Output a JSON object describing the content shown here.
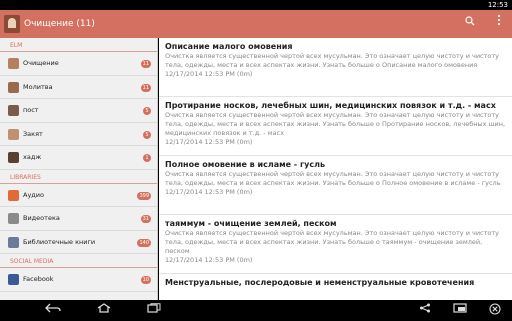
{
  "status_bar": {
    "time": "12:53"
  },
  "action_bar": {
    "title": "Очищение (11)",
    "search_icon": "search-icon",
    "overflow_icon": "overflow-menu-icon",
    "accent_color": "#d4705f"
  },
  "drawer": {
    "sections": [
      {
        "header": "ELM",
        "items": [
          {
            "label": "Очищение",
            "badge": "11",
            "icon": "kneeling-figure-icon"
          },
          {
            "label": "Молитва",
            "badge": "11",
            "icon": "prayer-figure-icon"
          },
          {
            "label": "пост",
            "badge": "5",
            "icon": "fasting-icon"
          },
          {
            "label": "Закят",
            "badge": "5",
            "icon": "zakat-icon"
          },
          {
            "label": "хадж",
            "badge": "1",
            "icon": "hajj-icon"
          }
        ]
      },
      {
        "header": "LIBRARIES",
        "items": [
          {
            "label": "Аудио",
            "badge": "399",
            "icon": "audio-icon"
          },
          {
            "label": "Видеотека",
            "badge": "31",
            "icon": "video-icon"
          },
          {
            "label": "Библиотечные книги",
            "badge": "140",
            "icon": "books-icon"
          }
        ]
      },
      {
        "header": "SOCIAL MEDIA",
        "items": [
          {
            "label": "Facebook",
            "badge": "10",
            "icon": "facebook-icon"
          }
        ]
      }
    ]
  },
  "articles": [
    {
      "title": "Описание малого омовения",
      "body": "Очистка является существенной чертой всех мусульман. Это означает целую чистоту и чистоту тела, одежды, места и всех аспектах жизни. Узнать больше о Описание малого омовения",
      "date": "12/17/2014 12:53 PM (0m)"
    },
    {
      "title": "Протирание носков, лечебных шин, медицинских повязок и т.д. - масх",
      "body": "Очистка является существенной чертой всех мусульман. Это означает целую чистоту и чистоту тела, одежды, места и всех аспектах жизни. Узнать больше о Протирание носков, лечебных шин, медицинских повязок и т.д. - масх",
      "date": "12/17/2014 12:53 PM (0m)"
    },
    {
      "title": "Полное омовение в исламе - гусль",
      "body": "Очистка является существенной чертой всех мусульман. Это означает целую чистоту и чистоту тела, одежды, места и всех аспектах жизни. Узнать больше о Полное омовение в исламе - гусль",
      "date": "12/17/2014 12:53 PM (0m)"
    },
    {
      "title": "таяммум - очищение землей, песком",
      "body": "Очистка является существенной чертой всех мусульман. Это означает целую чистоту и чистоту тела, одежды, места и всех аспектах жизни. Узнать больше о таяммум - очищение землей, песком",
      "date": "12/17/2014 12:53 PM (0m)"
    },
    {
      "title": "Менструальные, послеродовые и неменструальные кровотечения",
      "body": "",
      "date": ""
    }
  ],
  "nav_bar": {
    "back_icon": "back-icon",
    "home_icon": "home-icon",
    "recents_icon": "recents-icon",
    "share_icon": "share-icon",
    "window_icon": "window-icon",
    "close_icon": "close-icon"
  }
}
